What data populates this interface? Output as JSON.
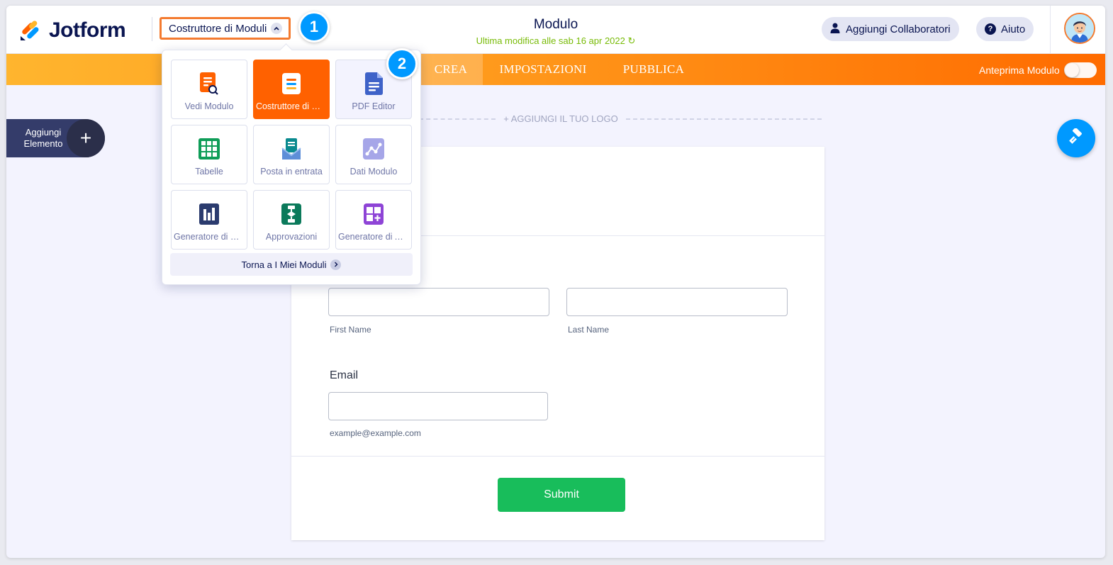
{
  "header": {
    "logo_text": "Jotform",
    "builder_menu_label": "Costruttore di Moduli",
    "form_title": "Modulo",
    "last_modified": "Ultima modifica alle sab 16 apr 2022",
    "collaborators_label": "Aggiungi Collaboratori",
    "help_label": "Aiuto"
  },
  "step_badges": [
    "1",
    "2"
  ],
  "nav": {
    "tabs": [
      {
        "label": "CREA",
        "active": true
      },
      {
        "label": "IMPOSTAZIONI",
        "active": false
      },
      {
        "label": "PUBBLICA",
        "active": false
      }
    ],
    "preview_label": "Anteprima Modulo",
    "preview_enabled": false
  },
  "add_element": {
    "line1": "Aggiungi",
    "line2": "Elemento",
    "plus": "+"
  },
  "logo_placeholder": "+ AGGIUNGI IL TUO LOGO",
  "form": {
    "first_name_sub": "First Name",
    "last_name_sub": "Last Name",
    "email_label": "Email",
    "email_sub": "example@example.com",
    "submit_label": "Submit"
  },
  "dropdown": {
    "tiles": [
      {
        "label": "Vedi Modulo",
        "icon": "view-form-icon"
      },
      {
        "label": "Costruttore di Moduli",
        "icon": "form-builder-icon",
        "active": true
      },
      {
        "label": "PDF Editor",
        "icon": "pdf-editor-icon"
      },
      {
        "label": "Tabelle",
        "icon": "tables-icon"
      },
      {
        "label": "Posta in entrata",
        "icon": "inbox-icon"
      },
      {
        "label": "Dati Modulo",
        "icon": "form-data-icon"
      },
      {
        "label": "Generatore di Report",
        "icon": "report-builder-icon"
      },
      {
        "label": "Approvazioni",
        "icon": "approvals-icon"
      },
      {
        "label": "Generatore di App",
        "icon": "app-builder-icon"
      }
    ],
    "back_label": "Torna a I Miei Moduli"
  },
  "colors": {
    "brand_navy": "#0a1551",
    "accent_orange": "#ff6100",
    "accent_blue": "#0099ff",
    "submit_green": "#18bd5b",
    "modified_green": "#78bb07"
  }
}
